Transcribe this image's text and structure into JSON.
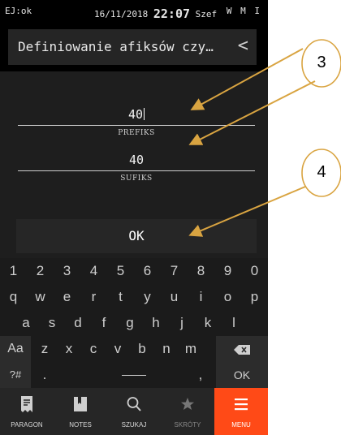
{
  "statusbar": {
    "left": "EJ:ok",
    "date": "16/11/2018",
    "time": "22:07",
    "user": "Szef",
    "right": "W M I"
  },
  "header": {
    "title": "Definiowanie afiksów czy…",
    "back_glyph": "<"
  },
  "fields": {
    "prefix": {
      "value": "40",
      "label": "PREFIKS"
    },
    "suffix": {
      "value": "40",
      "label": "SUFIKS"
    }
  },
  "ok_button": {
    "label": "OK"
  },
  "keyboard": {
    "digits": [
      "1",
      "2",
      "3",
      "4",
      "5",
      "6",
      "7",
      "8",
      "9",
      "0"
    ],
    "row1": [
      "q",
      "w",
      "e",
      "r",
      "t",
      "y",
      "u",
      "i",
      "o",
      "p"
    ],
    "row2": [
      "a",
      "s",
      "d",
      "f",
      "g",
      "h",
      "j",
      "k",
      "l"
    ],
    "row3": [
      "Aa",
      "z",
      "x",
      "c",
      "v",
      "b",
      "n",
      "m"
    ],
    "symbols_key": "?#",
    "period_key": ".",
    "comma_key": ",",
    "ok_key": "OK"
  },
  "bottomnav": {
    "items": [
      {
        "label": "PARAGON",
        "icon": "receipt-icon"
      },
      {
        "label": "NOTES",
        "icon": "notebook-icon"
      },
      {
        "label": "SZUKAJ",
        "icon": "search-icon"
      },
      {
        "label": "SKRÓTY",
        "icon": "star-icon"
      },
      {
        "label": "MENU",
        "icon": "menu-icon"
      }
    ],
    "active_color": "#ff4a17"
  },
  "annotations": {
    "callout_a": "3",
    "callout_b": "4"
  }
}
